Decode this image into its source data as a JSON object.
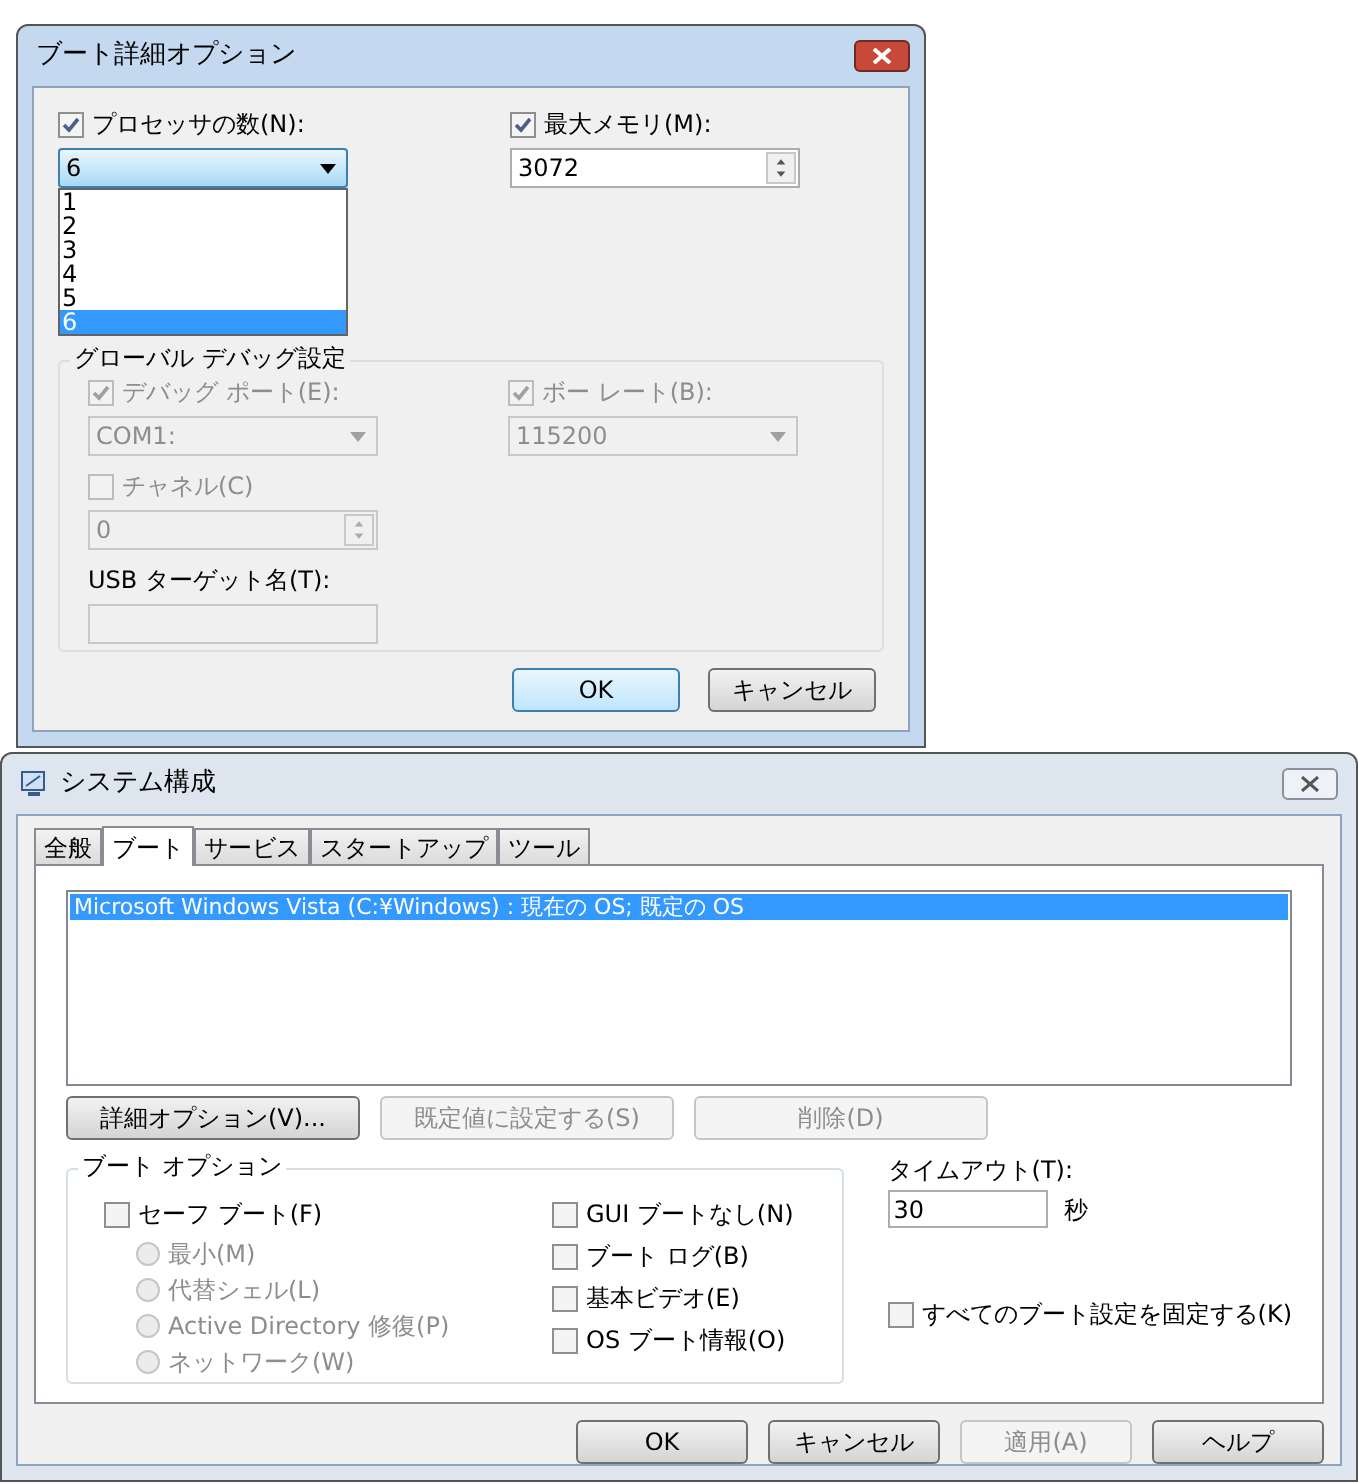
{
  "advanced_dialog": {
    "title": "ブート詳細オプション",
    "processors": {
      "label": "プロセッサの数(N):",
      "checked": true,
      "value": "6",
      "expanded": true,
      "options": [
        {
          "label": "1",
          "selected": false
        },
        {
          "label": "2",
          "selected": false
        },
        {
          "label": "3",
          "selected": false
        },
        {
          "label": "4",
          "selected": false
        },
        {
          "label": "5",
          "selected": false
        },
        {
          "label": "6",
          "selected": true
        }
      ]
    },
    "max_memory": {
      "label": "最大メモリ(M):",
      "checked": true,
      "value": "3072"
    },
    "debug_group": {
      "title": "グローバル デバッグ設定",
      "debug_port": {
        "label": "デバッグ ポート(E):",
        "checked": true,
        "disabled": true,
        "value": "COM1:"
      },
      "baud_rate": {
        "label": "ボー レート(B):",
        "checked": true,
        "disabled": true,
        "value": "115200"
      },
      "channel": {
        "label": "チャネル(C)",
        "checked": false,
        "disabled": true,
        "value": "0"
      },
      "usb_target": {
        "label": "USB ターゲット名(T):",
        "disabled": true
      }
    },
    "buttons": [
      {
        "label": "OK",
        "default": true
      },
      {
        "label": "キャンセル",
        "default": false
      }
    ]
  },
  "system_config": {
    "title": "システム構成",
    "tabs": [
      {
        "label": "全般",
        "selected": false
      },
      {
        "label": "ブート",
        "selected": true
      },
      {
        "label": "サービス",
        "selected": false
      },
      {
        "label": "スタートアップ",
        "selected": false
      },
      {
        "label": "ツール",
        "selected": false
      }
    ],
    "boot_entries": [
      {
        "label": "Microsoft Windows Vista (C:¥Windows) : 現在の OS; 既定の OS",
        "selected": true
      }
    ],
    "entry_buttons": [
      {
        "label": "詳細オプション(V)...",
        "disabled": false
      },
      {
        "label": "既定値に設定する(S)",
        "disabled": true
      },
      {
        "label": "削除(D)",
        "disabled": true
      }
    ],
    "boot_options": {
      "title": "ブート オプション",
      "safe_boot": {
        "label": "セーフ ブート(F)",
        "checked": false
      },
      "safe_modes": [
        {
          "label": "最小(M)",
          "selected": false,
          "disabled": true
        },
        {
          "label": "代替シェル(L)",
          "selected": false,
          "disabled": true
        },
        {
          "label": "Active Directory 修復(P)",
          "selected": false,
          "disabled": true
        },
        {
          "label": "ネットワーク(W)",
          "selected": false,
          "disabled": true
        }
      ],
      "flags": [
        {
          "label": "GUI ブートなし(N)",
          "checked": false
        },
        {
          "label": "ブート ログ(B)",
          "checked": false
        },
        {
          "label": "基本ビデオ(E)",
          "checked": false
        },
        {
          "label": "OS ブート情報(O)",
          "checked": false
        }
      ]
    },
    "timeout": {
      "label": "タイムアウト(T):",
      "value": "30",
      "unit": "秒"
    },
    "persist": {
      "label": "すべてのブート設定を固定する(K)",
      "checked": false
    },
    "buttons": [
      {
        "label": "OK",
        "disabled": false
      },
      {
        "label": "キャンセル",
        "disabled": false
      },
      {
        "label": "適用(A)",
        "disabled": true
      },
      {
        "label": "ヘルプ",
        "disabled": false
      }
    ]
  }
}
